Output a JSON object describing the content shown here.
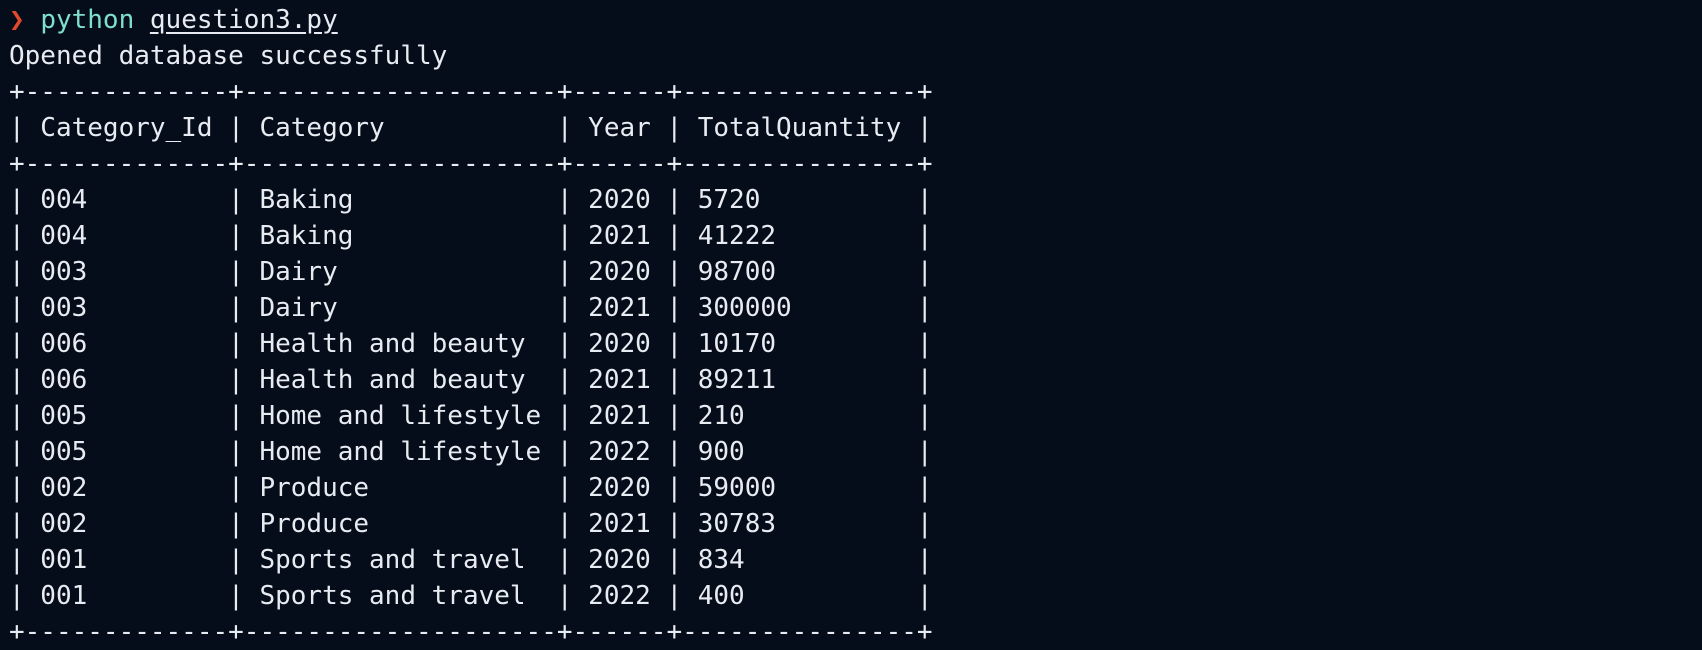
{
  "prompt": {
    "arrow": "❯",
    "command": "python",
    "argument": "question3.py"
  },
  "output": {
    "status": "Opened database successfully"
  },
  "table": {
    "columns": [
      "Category_Id",
      "Category",
      "Year",
      "TotalQuantity"
    ],
    "rows": [
      [
        "004",
        "Baking",
        "2020",
        "5720"
      ],
      [
        "004",
        "Baking",
        "2021",
        "41222"
      ],
      [
        "003",
        "Dairy",
        "2020",
        "98700"
      ],
      [
        "003",
        "Dairy",
        "2021",
        "300000"
      ],
      [
        "006",
        "Health and beauty",
        "2020",
        "10170"
      ],
      [
        "006",
        "Health and beauty",
        "2021",
        "89211"
      ],
      [
        "005",
        "Home and lifestyle",
        "2021",
        "210"
      ],
      [
        "005",
        "Home and lifestyle",
        "2022",
        "900"
      ],
      [
        "002",
        "Produce",
        "2020",
        "59000"
      ],
      [
        "002",
        "Produce",
        "2021",
        "30783"
      ],
      [
        "001",
        "Sports and travel",
        "2020",
        "834"
      ],
      [
        "001",
        "Sports and travel",
        "2022",
        "400"
      ]
    ]
  },
  "colors": {
    "background": "#050d1a",
    "text": "#e8ecf2",
    "prompt_arrow": "#e0492c",
    "command": "#7ee0cc"
  }
}
